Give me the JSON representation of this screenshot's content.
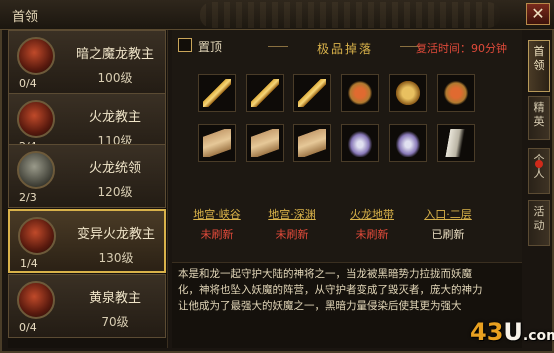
{
  "window": {
    "title": "首领",
    "close_glyph": "✕"
  },
  "bosses": [
    {
      "name": "暗之魔龙教主",
      "level": "100级",
      "count": "0/4",
      "portrait": "dark"
    },
    {
      "name": "火龙教主",
      "level": "110级",
      "count": "2/4",
      "portrait": "red"
    },
    {
      "name": "火龙统领",
      "level": "120级",
      "count": "2/3",
      "portrait": "gray"
    },
    {
      "name": "变异火龙教主",
      "level": "130级",
      "count": "1/4",
      "portrait": "red",
      "selected": true
    },
    {
      "name": "黄泉教主",
      "level": "70级",
      "count": "0/4",
      "portrait": "dark"
    }
  ],
  "detail": {
    "pin_label": "置顶",
    "section_title": "极品掉落",
    "respawn": "复活时间：90分钟",
    "drops_row1": [
      "weapon",
      "weapon",
      "weapon",
      "armor",
      "helm",
      "armor"
    ],
    "drops_row2": [
      "book",
      "book",
      "book",
      "gem",
      "gem",
      "crystal"
    ],
    "locations": [
      {
        "name": "地宫·峡谷",
        "state": "未刷新"
      },
      {
        "name": "地宫·深渊",
        "state": "未刷新"
      },
      {
        "name": "火龙地带",
        "state": "未刷新"
      },
      {
        "name": "入口·二层",
        "state": "已刷新"
      }
    ],
    "description": "本是和龙一起守护大陆的神将之一，当龙被黑暗势力拉拢而妖魔化，神将也坠入妖魔的阵营，从守护者变成了毁灭者，庞大的神力让他成为了最强大的妖魔之一，黑暗力量侵染后使其更为强大"
  },
  "tabs": [
    "首领",
    "精英",
    "个人",
    "活动"
  ],
  "watermark": {
    "prefix": "43",
    "suffix": "U",
    "tld": ".com"
  },
  "colors": {
    "accent": "#d9b24a",
    "alert": "#e04a3a"
  }
}
